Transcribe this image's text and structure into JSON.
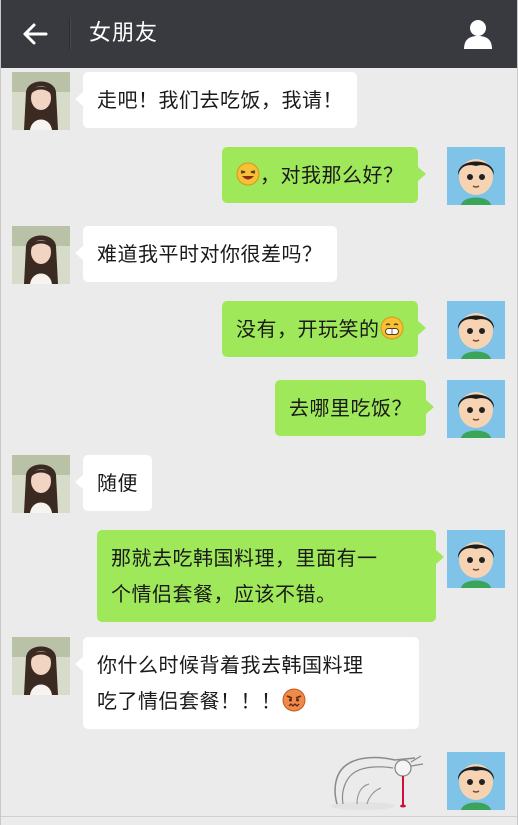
{
  "header": {
    "title": "女朋友",
    "back_icon": "arrow-left-icon",
    "profile_icon": "person-icon"
  },
  "colors": {
    "header_bg": "#393a3f",
    "chat_bg": "#ebebeb",
    "sent_bubble": "#9fe85a",
    "received_bubble": "#ffffff"
  },
  "messages": [
    {
      "from": "girlfriend",
      "text": "走吧！我们去吃饭，我请！"
    },
    {
      "from": "me",
      "emoji_before": "squinting-laugh-emoji",
      "text": "，对我那么好？"
    },
    {
      "from": "girlfriend",
      "text": "难道我平时对你很差吗？"
    },
    {
      "from": "me",
      "text": "没有，开玩笑的",
      "emoji_after": "grinning-emoji"
    },
    {
      "from": "me",
      "text": "去哪里吃饭？"
    },
    {
      "from": "girlfriend",
      "text": "随便"
    },
    {
      "from": "me",
      "lines": [
        "那就去吃韩国料理，里面有一",
        "个情侣套餐，应该不错。"
      ]
    },
    {
      "from": "girlfriend",
      "lines": [
        "你什么时候背着我去韩国料理",
        "吃了情侣套餐！！！"
      ],
      "emoji_after": "angry-face-emoji"
    },
    {
      "from": "me",
      "sticker": "bleeding-bow-sticker"
    }
  ]
}
